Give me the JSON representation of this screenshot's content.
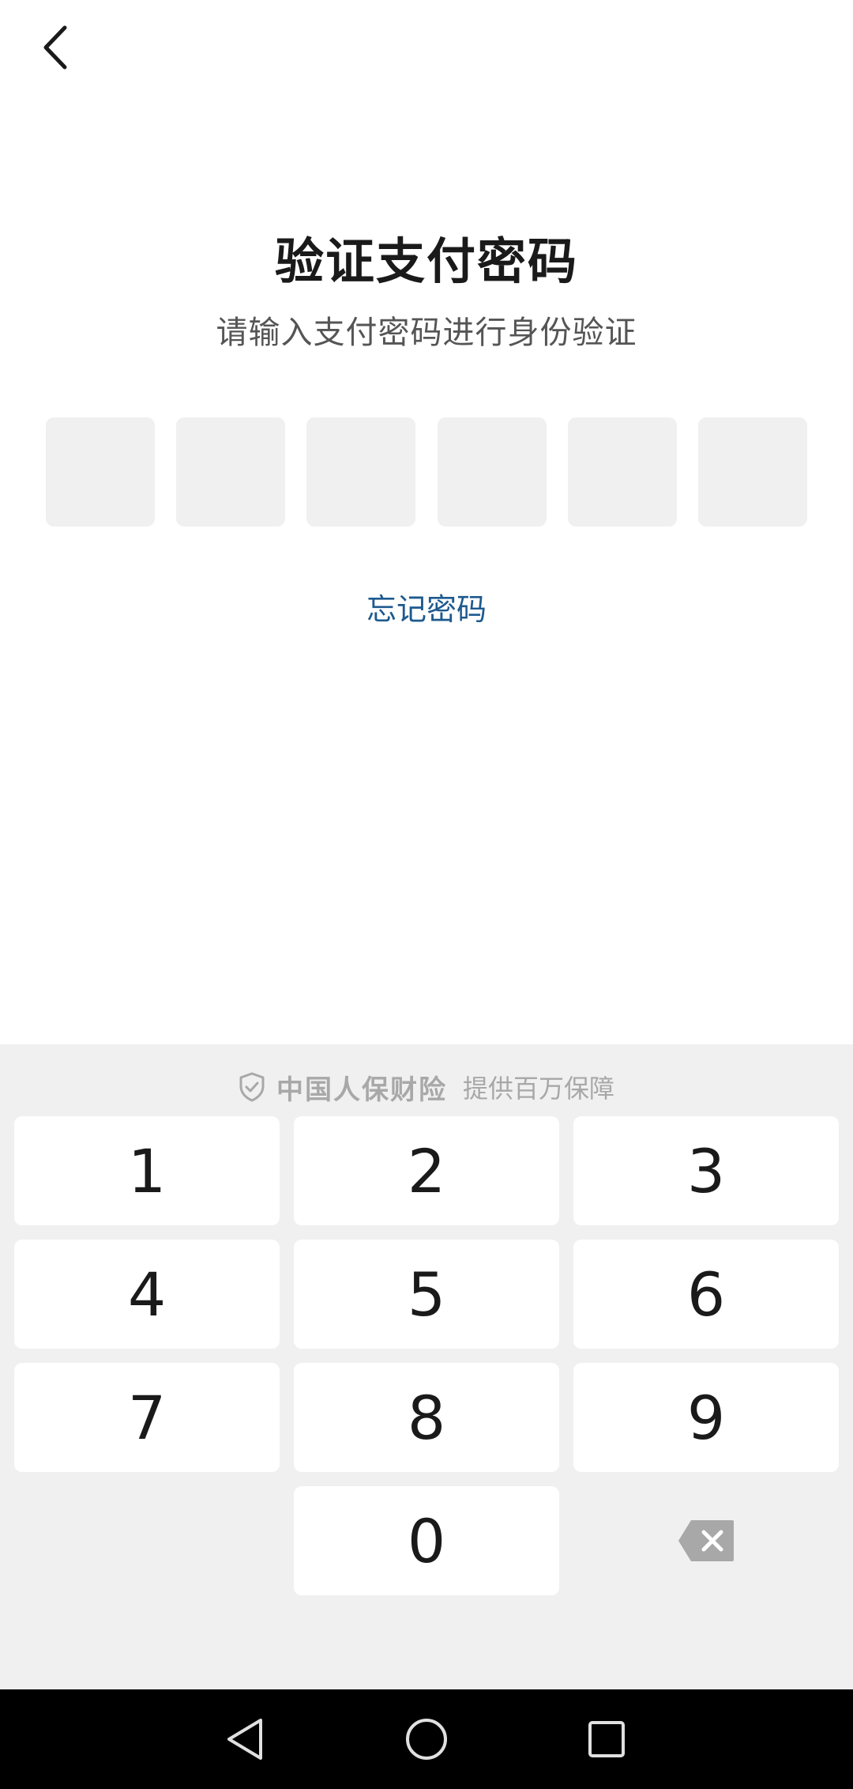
{
  "header": {
    "back_icon": "chevron-left-icon"
  },
  "main": {
    "title": "验证支付密码",
    "subtitle": "请输入支付密码进行身份验证",
    "pin_length": 6,
    "forgot_label": "忘记密码"
  },
  "keyboard": {
    "shield_icon": "shield-check-icon",
    "brand": "中国人保财险",
    "slogan": "提供百万保障",
    "keys": {
      "k1": "1",
      "k2": "2",
      "k3": "3",
      "k4": "4",
      "k5": "5",
      "k6": "6",
      "k7": "7",
      "k8": "8",
      "k9": "9",
      "k0": "0"
    },
    "delete_icon": "backspace-icon"
  },
  "system_nav": {
    "back_icon": "triangle-back-icon",
    "home_icon": "circle-home-icon",
    "recents_icon": "square-recents-icon"
  },
  "colors": {
    "accent": "#1d5a8f",
    "keyboard_bg": "#f0f0f0",
    "pin_box_bg": "#f0f0f0",
    "navbar_bg": "#000000"
  }
}
